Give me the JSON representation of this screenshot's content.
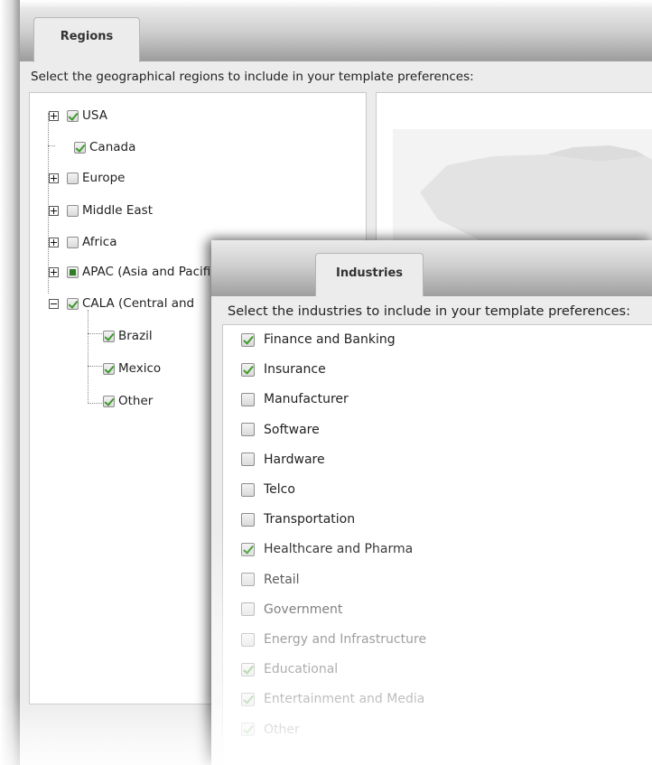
{
  "regions": {
    "tab_label": "Regions",
    "instruction": "Select the geographical regions to include in your template preferences:",
    "items": [
      {
        "label": "USA",
        "state": "checked",
        "expander": "plus"
      },
      {
        "label": "Canada",
        "state": "checked",
        "expander": "none"
      },
      {
        "label": "Europe",
        "state": "unchecked",
        "expander": "plus"
      },
      {
        "label": "Middle East",
        "state": "unchecked",
        "expander": "plus"
      },
      {
        "label": "Africa",
        "state": "unchecked",
        "expander": "plus"
      },
      {
        "label": "APAC (Asia and Pacific)",
        "state": "partial",
        "expander": "plus"
      },
      {
        "label": "CALA (Central and",
        "state": "checked",
        "expander": "minus",
        "children": [
          {
            "label": "Brazil",
            "state": "checked"
          },
          {
            "label": "Mexico",
            "state": "checked"
          },
          {
            "label": "Other",
            "state": "checked"
          }
        ]
      }
    ]
  },
  "industries": {
    "tab_label": "Industries",
    "instruction": "Select the industries to include in your template preferences:",
    "items": [
      {
        "label": "Finance and Banking",
        "checked": true
      },
      {
        "label": "Insurance",
        "checked": true
      },
      {
        "label": "Manufacturer",
        "checked": false
      },
      {
        "label": "Software",
        "checked": false
      },
      {
        "label": "Hardware",
        "checked": false
      },
      {
        "label": "Telco",
        "checked": false
      },
      {
        "label": "Transportation",
        "checked": false
      },
      {
        "label": "Healthcare and Pharma",
        "checked": true
      },
      {
        "label": "Retail",
        "checked": false
      },
      {
        "label": "Government",
        "checked": false
      },
      {
        "label": "Energy and Infrastructure",
        "checked": false
      },
      {
        "label": "Educational",
        "checked": true
      },
      {
        "label": "Entertainment and Media",
        "checked": true
      },
      {
        "label": "Other",
        "checked": true
      }
    ]
  },
  "colors": {
    "panel_bg": "#ececec",
    "check_green": "#3d9a2a",
    "border": "#c9c9c9"
  }
}
